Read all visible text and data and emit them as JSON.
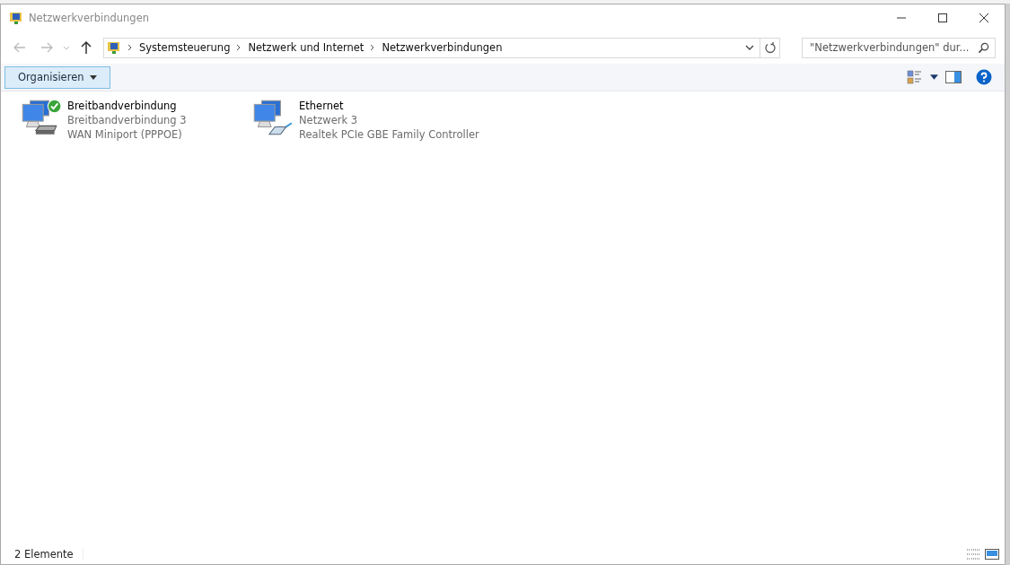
{
  "window": {
    "title": "Netzwerkverbindungen"
  },
  "address_bar": {
    "path": [
      "Systemsteuerung",
      "Netzwerk und Internet",
      "Netzwerkverbindungen"
    ]
  },
  "search": {
    "placeholder": "\"Netzwerkverbindungen\" dur..."
  },
  "toolbar": {
    "organize_button": "Organisieren"
  },
  "connections": [
    {
      "name": "Breitbandverbindung",
      "network": "Breitbandverbindung  3",
      "device": "WAN Miniport (PPPOE)",
      "kind": "modem",
      "connected": true
    },
    {
      "name": "Ethernet",
      "network": "Netzwerk  3",
      "device": "Realtek PCIe GBE Family Controller",
      "kind": "cable",
      "connected": false
    }
  ],
  "status_bar": {
    "count": "2 Elemente"
  }
}
